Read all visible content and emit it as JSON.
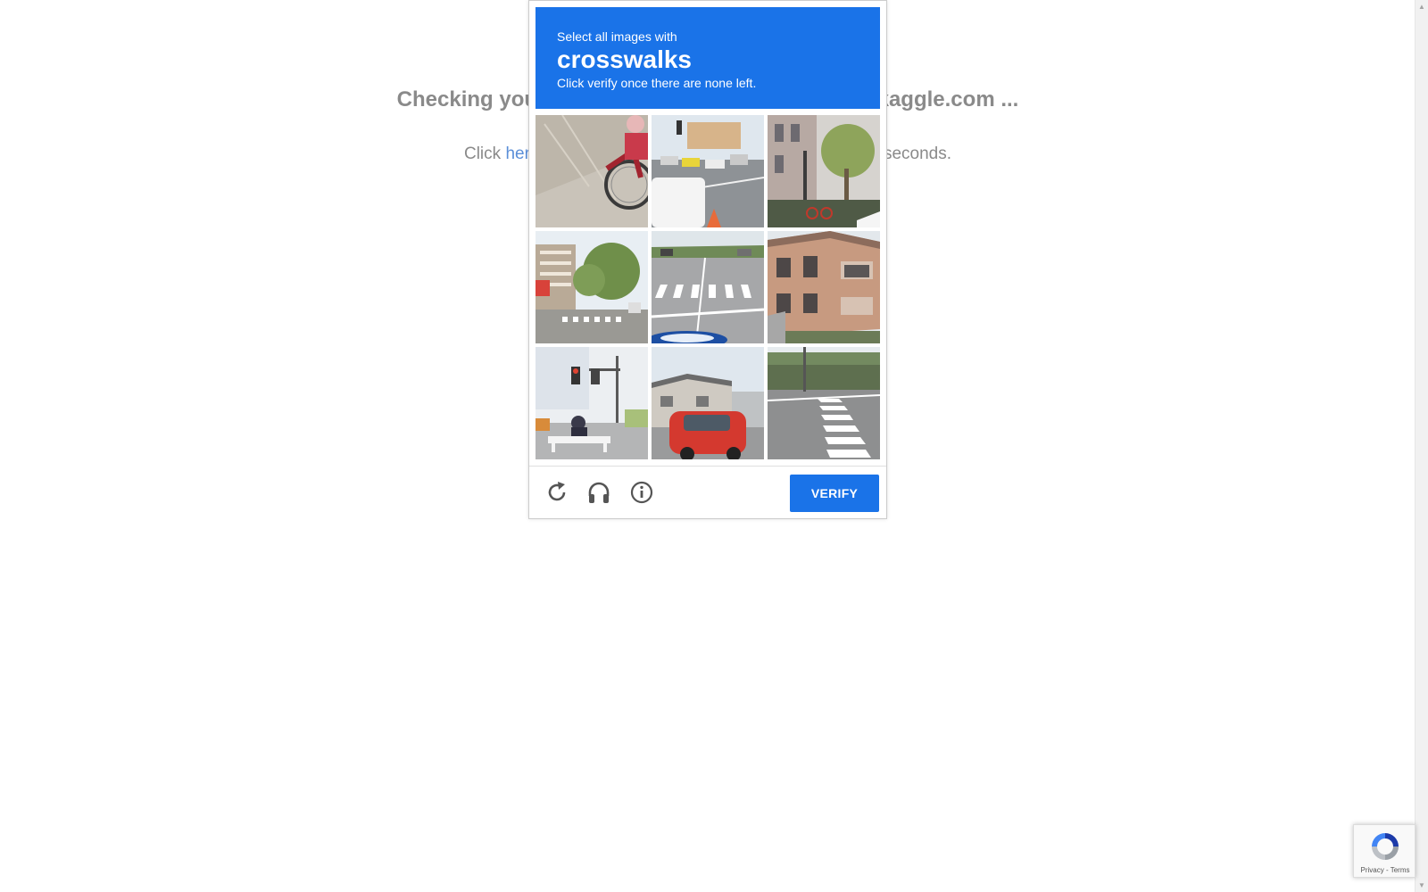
{
  "background": {
    "heading": "Checking your browser before accessing www.kaggle.com ...",
    "sub_before": "Click ",
    "sub_link": "here",
    "sub_after": " if you are not automatically redirected after 5 seconds."
  },
  "challenge": {
    "instruction": "Select all images with",
    "keyword": "crosswalks",
    "subinstruction": "Click verify once there are none left.",
    "tiles": [
      {
        "description": "bicycle-wheel"
      },
      {
        "description": "traffic-cars"
      },
      {
        "description": "street-trees-bike"
      },
      {
        "description": "street-apartments-crosswalk"
      },
      {
        "description": "intersection-crosswalk"
      },
      {
        "description": "apartment-building"
      },
      {
        "description": "traffic-light-corner"
      },
      {
        "description": "red-car-house"
      },
      {
        "description": "crosswalk-stripes"
      }
    ],
    "verify_label": "VERIFY",
    "icons": [
      "reload-icon",
      "audio-headphones-icon",
      "info-icon"
    ]
  },
  "badge": {
    "links": "Privacy - Terms"
  },
  "colors": {
    "accent": "#1a73e8",
    "muted_text": "#8a8a8a",
    "link": "#5b8fd8"
  }
}
